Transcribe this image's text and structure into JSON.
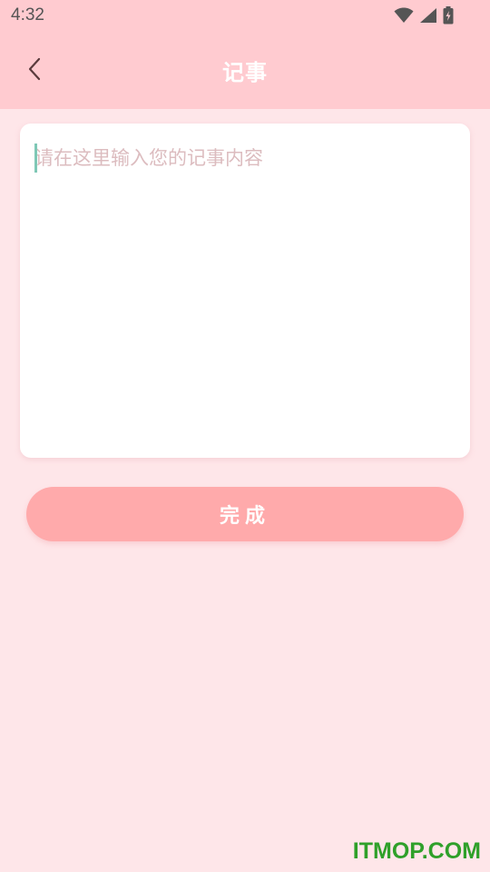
{
  "status_bar": {
    "time": "4:32",
    "icons": [
      "wifi-icon",
      "cellular-signal-icon",
      "battery-charging-icon"
    ]
  },
  "app_bar": {
    "back_icon": "chevron-left-icon",
    "title": "记事"
  },
  "note_editor": {
    "value": "",
    "placeholder": "请在这里输入您的记事内容"
  },
  "actions": {
    "done_label": "完成"
  },
  "watermark": {
    "text": "ITMOP.COM"
  },
  "colors": {
    "page_background": "#fee6e9",
    "header_background": "#ffcbd0",
    "card_background": "#ffffff",
    "button_background": "#ffaaab",
    "placeholder_text": "#dcbcbf",
    "cursor": "#7fc8b6",
    "watermark": "#2fa02a"
  }
}
